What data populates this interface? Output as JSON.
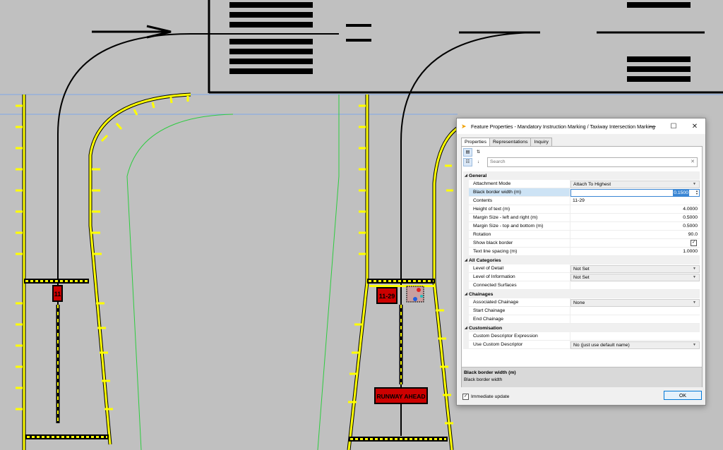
{
  "canvas": {
    "sign_labels": {
      "left_sign": "11",
      "right_sign": "11-29",
      "runway_ahead": "RUNWAY AHEAD"
    }
  },
  "dialog": {
    "title": "Feature Properties - Mandatory Instruction Marking / Taxiway Intersection Marking",
    "title_icon": "wand-icon",
    "window_buttons": {
      "minimize": "—",
      "maximize": "☐",
      "close": "✕"
    },
    "tabs": [
      {
        "label": "Properties",
        "active": true
      },
      {
        "label": "Representations",
        "active": false
      },
      {
        "label": "Inquiry",
        "active": false
      }
    ],
    "toolbar": {
      "categorized_icon": "categorized-icon",
      "alphabetical_icon": "sort-alpha-icon"
    },
    "search": {
      "placeholder": "Search",
      "clear": "✕"
    },
    "categories": {
      "general": {
        "label": "General",
        "rows": {
          "attachment_mode": {
            "name": "Attachment Mode",
            "value": "Attach To Highest"
          },
          "black_border_width": {
            "name": "Black border width (m)",
            "value": "0.1500"
          },
          "contents": {
            "name": "Contents",
            "value": "11-29"
          },
          "height_of_text": {
            "name": "Height of text (m)",
            "value": "4.0000"
          },
          "margin_lr": {
            "name": "Margin Size - left and right (m)",
            "value": "0.5000"
          },
          "margin_tb": {
            "name": "Margin Size - top and bottom (m)",
            "value": "0.5000"
          },
          "rotation": {
            "name": "Rotation",
            "value": "90.0"
          },
          "show_black_border": {
            "name": "Show black border",
            "checked": true
          },
          "text_line_spacing": {
            "name": "Text line spacing (m)",
            "value": "1.0000"
          }
        }
      },
      "all_categories": {
        "label": "All Categories",
        "rows": {
          "level_of_detail": {
            "name": "Level of Detail",
            "value": "Not Set"
          },
          "level_of_information": {
            "name": "Level of Information",
            "value": "Not Set"
          },
          "connected_surfaces": {
            "name": "Connected Surfaces",
            "value": ""
          }
        }
      },
      "chainages": {
        "label": "Chainages",
        "rows": {
          "associated_chainage": {
            "name": "Associated Chainage",
            "value": "None"
          },
          "start_chainage": {
            "name": "Start Chainage",
            "value": ""
          },
          "end_chainage": {
            "name": "End Chainage",
            "value": ""
          }
        }
      },
      "customisation": {
        "label": "Customisation",
        "rows": {
          "custom_descriptor_expression": {
            "name": "Custom Descriptor Expression",
            "value": ""
          },
          "use_custom_descriptor": {
            "name": "Use Custom Descriptor",
            "value": "No (just use default name)"
          }
        }
      }
    },
    "description": {
      "title": "Black border width (m)",
      "text": "Black border width"
    },
    "footer": {
      "immediate_update_label": "Immediate update",
      "immediate_update_checked": true,
      "ok_label": "OK"
    }
  },
  "colors": {
    "canvas_bg": "#c0c0c0",
    "taxiway_yellow": "#ffff00",
    "sign_red": "#cc0000",
    "guide_green": "#2ecc40",
    "guide_blue": "#7fa8e8",
    "selection_blue": "#3a86d4"
  }
}
